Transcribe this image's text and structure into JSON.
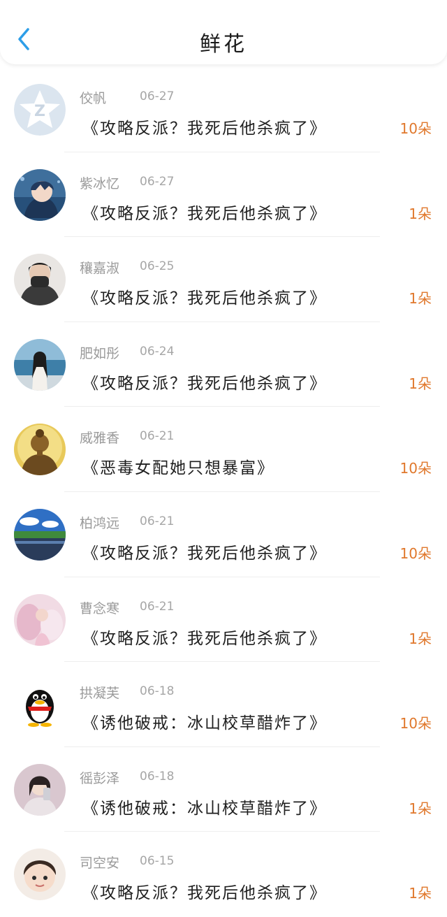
{
  "header": {
    "title": "鲜花"
  },
  "colors": {
    "accent": "#2d9ee8",
    "count": "#e0782c",
    "name": "#9a9a9a"
  },
  "items": [
    {
      "name": "佼帆",
      "date": "06-27",
      "book": "《攻略反派？我死后他杀疯了》",
      "count": "10朵",
      "avatar": "qzone-star"
    },
    {
      "name": "紫冰忆",
      "date": "06-27",
      "book": "《攻略反派？我死后他杀疯了》",
      "count": "1朵",
      "avatar": "anime-boy"
    },
    {
      "name": "穰嘉淑",
      "date": "06-25",
      "book": "《攻略反派？我死后他杀疯了》",
      "count": "1朵",
      "avatar": "masked-person"
    },
    {
      "name": "肥如彤",
      "date": "06-24",
      "book": "《攻略反派？我死后他杀疯了》",
      "count": "1朵",
      "avatar": "girl-seaside"
    },
    {
      "name": "威雅香",
      "date": "06-21",
      "book": "《恶毒女配她只想暴富》",
      "count": "10朵",
      "avatar": "buddha"
    },
    {
      "name": "柏鸿远",
      "date": "06-21",
      "book": "《攻略反派？我死后他杀疯了》",
      "count": "10朵",
      "avatar": "lake-landscape"
    },
    {
      "name": "曹念寒",
      "date": "06-21",
      "book": "《攻略反派？我死后他杀疯了》",
      "count": "1朵",
      "avatar": "pink-fairy"
    },
    {
      "name": "拱凝芙",
      "date": "06-18",
      "book": "《诱他破戒：冰山校草醋炸了》",
      "count": "10朵",
      "avatar": "qq-penguin"
    },
    {
      "name": "徭彭泽",
      "date": "06-18",
      "book": "《诱他破戒：冰山校草醋炸了》",
      "count": "1朵",
      "avatar": "girl-selfie"
    },
    {
      "name": "司空安",
      "date": "06-15",
      "book": "《攻略反派？我死后他杀疯了》",
      "count": "1朵",
      "avatar": "child"
    }
  ]
}
